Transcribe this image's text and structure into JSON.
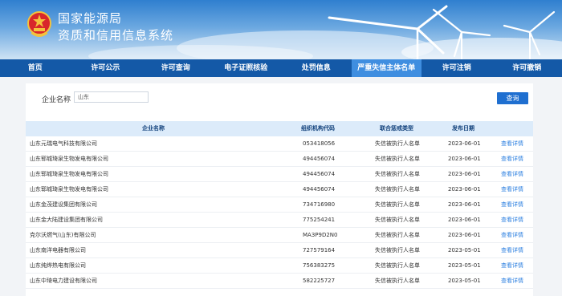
{
  "header": {
    "title_line1": "国家能源局",
    "title_line2": "资质和信用信息系统"
  },
  "nav": {
    "items": [
      "首页",
      "许可公示",
      "许可查询",
      "电子证照核验",
      "处罚信息",
      "严重失信主体名单",
      "许可注销",
      "许可撤销"
    ],
    "active_index": 5
  },
  "search": {
    "label": "企业名称",
    "value": "山东",
    "button": "查询"
  },
  "table": {
    "headers": [
      "企业名称",
      "组织机构代码",
      "联合惩戒类型",
      "发布日期"
    ],
    "detail_label": "查看详情",
    "rows": [
      {
        "name": "山东元瑞电气科技有限公司",
        "code": "053418056",
        "type": "失信被执行人名单",
        "date": "2023-06-01"
      },
      {
        "name": "山东郓城琦泉生物发电有限公司",
        "code": "494456074",
        "type": "失信被执行人名单",
        "date": "2023-06-01"
      },
      {
        "name": "山东郓城琦泉生物发电有限公司",
        "code": "494456074",
        "type": "失信被执行人名单",
        "date": "2023-06-01"
      },
      {
        "name": "山东郓城琦泉生物发电有限公司",
        "code": "494456074",
        "type": "失信被执行人名单",
        "date": "2023-06-01"
      },
      {
        "name": "山东金茂建设集团有限公司",
        "code": "734716980",
        "type": "失信被执行人名单",
        "date": "2023-06-01"
      },
      {
        "name": "山东金大陆建设集团有限公司",
        "code": "775254241",
        "type": "失信被执行人名单",
        "date": "2023-06-01"
      },
      {
        "name": "克尔沃燃气(山东)有限公司",
        "code": "MA3P9D2N0",
        "type": "失信被执行人名单",
        "date": "2023-06-01"
      },
      {
        "name": "山东南洋电器有限公司",
        "code": "727579164",
        "type": "失信被执行人名单",
        "date": "2023-05-01"
      },
      {
        "name": "山东纯烨热电有限公司",
        "code": "756383275",
        "type": "失信被执行人名单",
        "date": "2023-05-01"
      },
      {
        "name": "山东中琦电力建设有限公司",
        "code": "582225727",
        "type": "失信被执行人名单",
        "date": "2023-05-01"
      }
    ]
  },
  "colors": {
    "nav_bg": "#1459a7",
    "nav_active": "#3f8ee0",
    "table_header_bg": "#dcebfa",
    "link": "#2b7fe0",
    "button": "#1f6fd0"
  }
}
